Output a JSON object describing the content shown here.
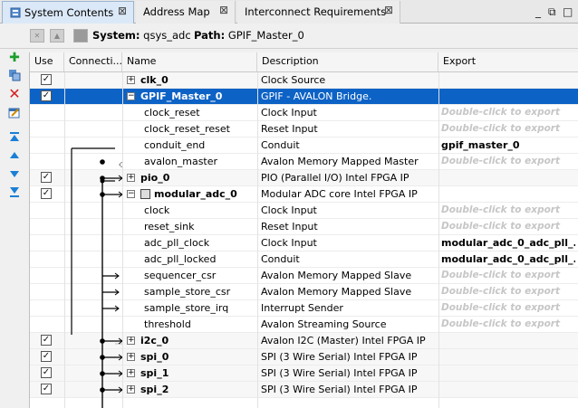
{
  "tabs": [
    {
      "label": "System Contents",
      "active": true
    },
    {
      "label": "Address Map",
      "active": false
    },
    {
      "label": "Interconnect Requirements",
      "active": false
    }
  ],
  "toolbar": {
    "system_label": "System:",
    "system_value": "qsys_adc",
    "path_label": "Path:",
    "path_value": "GPIF_Master_0"
  },
  "columns": [
    "Use",
    "Connecti...",
    "Name",
    "Description",
    "Export"
  ],
  "rows": [
    {
      "name": "clk_0",
      "desc": "Clock Source",
      "export": "",
      "use": true,
      "expand": "+",
      "bold": true,
      "indent": 0,
      "alt": true
    },
    {
      "name": "GPIF_Master_0",
      "desc": "GPIF - AVALON Bridge.",
      "export": "",
      "use": true,
      "expand": "−",
      "bold": true,
      "indent": 0,
      "selected": true
    },
    {
      "name": "clock_reset",
      "desc": "Clock Input",
      "export": "Double-click to export",
      "indent": 1
    },
    {
      "name": "clock_reset_reset",
      "desc": "Reset Input",
      "export": "Double-click to export",
      "indent": 1
    },
    {
      "name": "conduit_end",
      "desc": "Conduit",
      "export": "gpif_master_0",
      "indent": 1,
      "exported": true
    },
    {
      "name": "avalon_master",
      "desc": "Avalon Memory Mapped Master",
      "export": "Double-click to export",
      "indent": 1
    },
    {
      "name": "pio_0",
      "desc": "PIO (Parallel I/O) Intel FPGA IP",
      "export": "",
      "use": true,
      "expand": "+",
      "bold": true,
      "indent": 0,
      "alt": true
    },
    {
      "name": "modular_adc_0",
      "desc": "Modular ADC core Intel FPGA IP",
      "export": "",
      "use": true,
      "expand": "−",
      "bold": true,
      "indent": 0,
      "modicon": true
    },
    {
      "name": "clock",
      "desc": "Clock Input",
      "export": "Double-click to export",
      "indent": 1
    },
    {
      "name": "reset_sink",
      "desc": "Reset Input",
      "export": "Double-click to export",
      "indent": 1
    },
    {
      "name": "adc_pll_clock",
      "desc": "Clock Input",
      "export": "modular_adc_0_adc_pll_...",
      "indent": 1,
      "exported": true
    },
    {
      "name": "adc_pll_locked",
      "desc": "Conduit",
      "export": "modular_adc_0_adc_pll_...",
      "indent": 1,
      "exported": true
    },
    {
      "name": "sequencer_csr",
      "desc": "Avalon Memory Mapped Slave",
      "export": "Double-click to export",
      "indent": 1
    },
    {
      "name": "sample_store_csr",
      "desc": "Avalon Memory Mapped Slave",
      "export": "Double-click to export",
      "indent": 1
    },
    {
      "name": "sample_store_irq",
      "desc": "Interrupt Sender",
      "export": "Double-click to export",
      "indent": 1
    },
    {
      "name": "threshold",
      "desc": "Avalon Streaming Source",
      "export": "Double-click to export",
      "indent": 1
    },
    {
      "name": "i2c_0",
      "desc": "Avalon I2C (Master) Intel FPGA IP",
      "export": "",
      "use": true,
      "expand": "+",
      "bold": true,
      "indent": 0,
      "alt": true
    },
    {
      "name": "spi_0",
      "desc": "SPI (3 Wire Serial) Intel FPGA IP",
      "export": "",
      "use": true,
      "expand": "+",
      "bold": true,
      "indent": 0,
      "alt": true
    },
    {
      "name": "spi_1",
      "desc": "SPI (3 Wire Serial) Intel FPGA IP",
      "export": "",
      "use": true,
      "expand": "+",
      "bold": true,
      "indent": 0,
      "alt": true
    },
    {
      "name": "spi_2",
      "desc": "SPI (3 Wire Serial) Intel FPGA IP",
      "export": "",
      "use": true,
      "expand": "+",
      "bold": true,
      "indent": 0,
      "alt": true
    }
  ],
  "icons": {
    "tab_icon": "system-contents-icon",
    "close": "close-icon",
    "lefttools": [
      "add-component-icon",
      "duplicate-icon",
      "remove-icon",
      "edit-icon",
      "move-top-icon",
      "move-up-icon",
      "move-down-icon",
      "move-bottom-icon"
    ]
  },
  "colors": {
    "selection": "#0d62c5",
    "add": "#1a9e2a",
    "remove": "#d42020",
    "arrows": "#1b7fd6"
  }
}
